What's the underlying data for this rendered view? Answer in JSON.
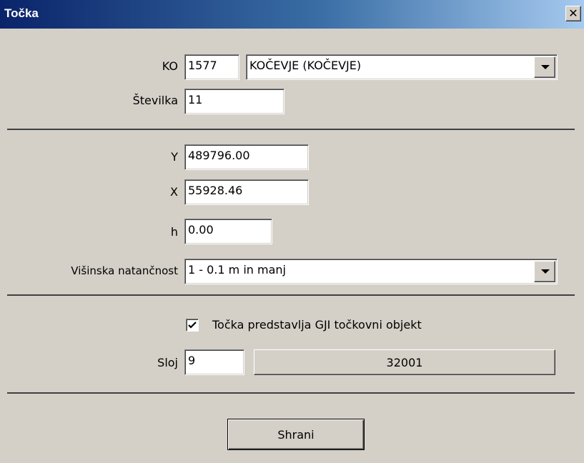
{
  "window": {
    "title": "Točka"
  },
  "ko": {
    "label": "KO",
    "code": "1577",
    "name": "KOČEVJE (KOČEVJE)"
  },
  "stevilka": {
    "label": "Številka",
    "value": "11"
  },
  "coords": {
    "y_label": "Y",
    "y_value": "489796.00",
    "x_label": "X",
    "x_value": "55928.46",
    "h_label": "h",
    "h_value": "0.00"
  },
  "accuracy": {
    "label": "Višinska natančnost",
    "value": "1 - 0.1 m in manj"
  },
  "gji": {
    "label": "Točka predstavlja GJI točkovni objekt",
    "checked": true
  },
  "sloj": {
    "label": "Sloj",
    "value": "9",
    "button_label": "32001"
  },
  "actions": {
    "save_label": "Shrani"
  },
  "icons": {
    "close": "close-icon",
    "dropdown": "chevron-down-icon",
    "check": "check-icon"
  }
}
